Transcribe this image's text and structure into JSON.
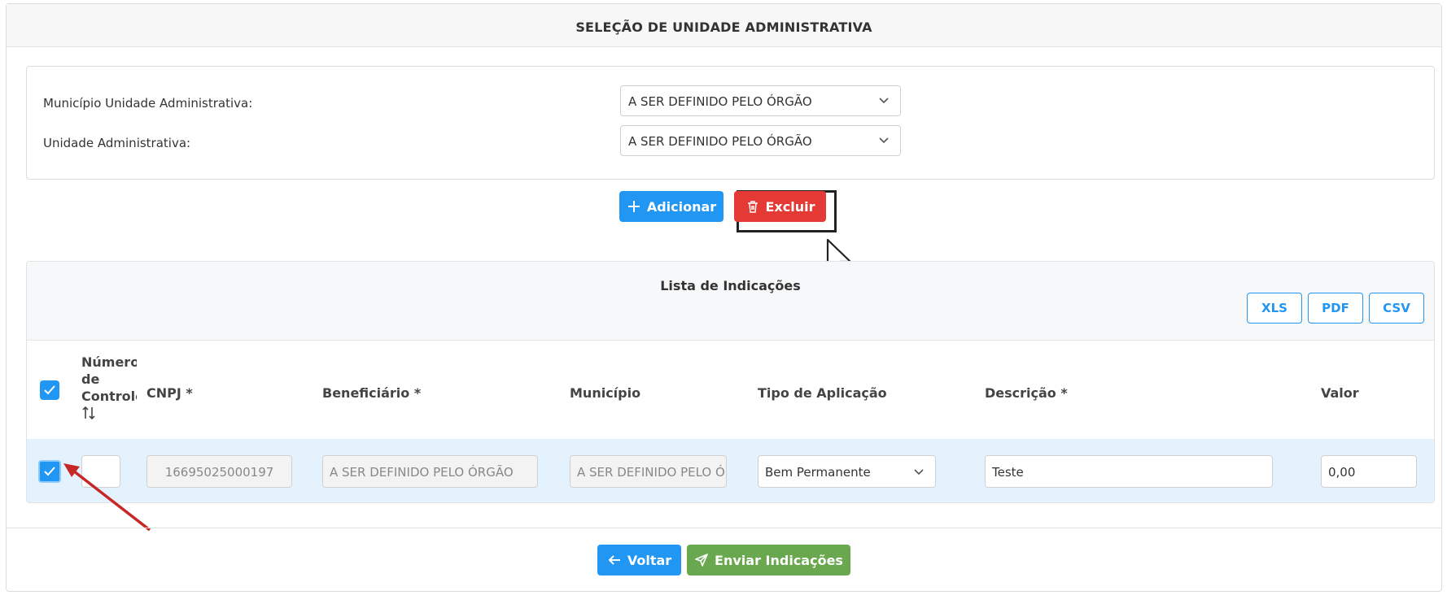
{
  "header": {
    "title": "SELEÇÃO DE UNIDADE ADMINISTRATIVA"
  },
  "form": {
    "municipio_label": "Município Unidade Administrativa:",
    "municipio_value": "A SER DEFINIDO PELO ÓRGÃO",
    "unidade_label": "Unidade Administrativa:",
    "unidade_value": "A SER DEFINIDO PELO ÓRGÃO"
  },
  "actions": {
    "add_label": "Adicionar",
    "delete_label": "Excluir"
  },
  "list": {
    "title": "Lista de Indicações",
    "export": [
      "XLS",
      "PDF",
      "CSV"
    ],
    "columns": {
      "numero_line1": "Número",
      "numero_line2": "de",
      "numero_line3": "Controle",
      "cnpj": "CNPJ *",
      "beneficiario": "Beneficiário *",
      "municipio": "Município",
      "tipo": "Tipo de Aplicação",
      "descricao": "Descrição *",
      "valor": "Valor"
    },
    "rows": [
      {
        "numero": "",
        "cnpj": "16695025000197",
        "beneficiario": "A SER DEFINIDO PELO ÓRGÃO",
        "municipio": "A SER DEFINIDO PELO ÓRGÃO",
        "tipo": "Bem Permanente",
        "descricao": "Teste",
        "valor": "0,00"
      }
    ]
  },
  "footer": {
    "back_label": "Voltar",
    "send_label": "Enviar Indicações"
  },
  "colors": {
    "primary": "#2196f3",
    "danger": "#e53935",
    "success": "#6aa84f",
    "selected_row": "#e3f2fd",
    "annotation": "#c62828"
  },
  "icons": [
    "chevron-down-icon",
    "plus-icon",
    "trash-icon",
    "sort-icon",
    "check-icon",
    "arrow-left-icon",
    "send-icon",
    "mouse-pointer-icon",
    "annotation-arrow-icon"
  ]
}
